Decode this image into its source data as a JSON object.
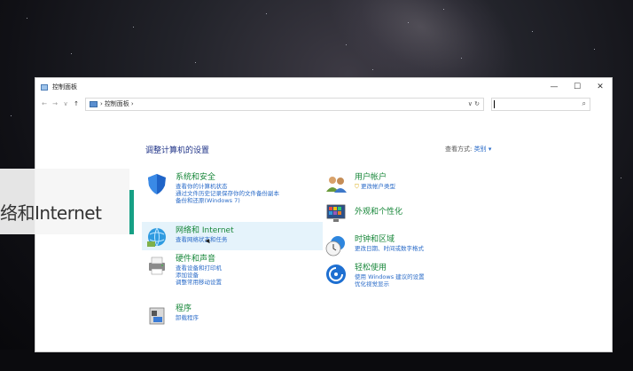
{
  "window": {
    "title": "控制面板",
    "address_crumb": "控制面板",
    "address_sep": "›",
    "address_tail": "›",
    "address_right": "∨ ↻",
    "search_placeholder": ""
  },
  "nav": {
    "back": "←",
    "forward": "→",
    "recent": "∨",
    "up": "↑"
  },
  "winctl": {
    "min": "—",
    "max": "☐",
    "close": "✕"
  },
  "heading": "调整计算机的设置",
  "view_by": {
    "label": "查看方式:",
    "value": "类别 ▾"
  },
  "left_categories": [
    {
      "title": "系统和安全",
      "links": [
        "查看你的计算机状态",
        "通过文件历史记录保存你的文件备份副本",
        "备份和还原(Windows 7)"
      ],
      "icon": "shield-icon"
    },
    {
      "title": "网络和 Internet",
      "links": [
        "查看网络状态和任务"
      ],
      "icon": "network-globe-icon"
    },
    {
      "title": "硬件和声音",
      "links": [
        "查看设备和打印机",
        "添加设备",
        "调整常用移动设置"
      ],
      "icon": "printer-icon"
    },
    {
      "title": "程序",
      "links": [
        "卸载程序"
      ],
      "icon": "programs-icon"
    }
  ],
  "right_categories": [
    {
      "title": "用户帐户",
      "links": [
        "更改帐户类型"
      ],
      "icon": "users-icon"
    },
    {
      "title": "外观和个性化",
      "links": [],
      "icon": "monitor-colors-icon"
    },
    {
      "title": "时钟和区域",
      "links": [
        "更改日期、时间或数字格式"
      ],
      "icon": "clock-globe-icon"
    },
    {
      "title": "轻松使用",
      "links": [
        "使用 Windows 建议的设置",
        "优化视觉显示"
      ],
      "icon": "ease-of-access-icon"
    }
  ],
  "overlay_caption": "络和Internet",
  "colors": {
    "category_green": "#18873a",
    "link_blue": "#2a6bc8",
    "heading_blue": "#1e3287",
    "accent_teal": "#16a085"
  }
}
